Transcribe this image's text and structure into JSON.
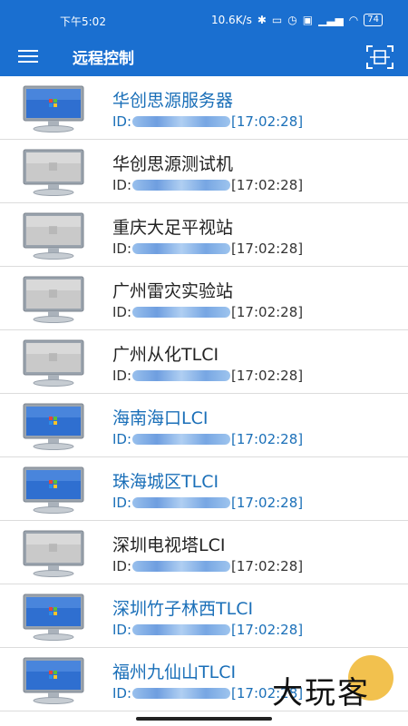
{
  "status_bar": {
    "time": "下午5:02",
    "network_speed": "10.6K/s",
    "icons": [
      "bluetooth-icon",
      "vibrate-icon",
      "alarm-icon",
      "hd-icon",
      "signal-4g-icon",
      "wifi-icon"
    ],
    "battery": "74"
  },
  "app_bar": {
    "title": "远程控制",
    "menu_icon": "hamburger-menu-icon",
    "scan_icon": "scan-code-icon"
  },
  "colors": {
    "primary": "#1a6fd0",
    "online_text": "#1a6fb8",
    "offline_text": "#222222",
    "fab": "#f2c14e"
  },
  "devices": [
    {
      "name": "华创思源服务器",
      "id_prefix": "ID:",
      "time": "[17:02:28]",
      "online": true
    },
    {
      "name": "华创思源测试机",
      "id_prefix": "ID:",
      "time": "[17:02:28]",
      "online": false
    },
    {
      "name": "重庆大足平视站",
      "id_prefix": "ID:",
      "time": "[17:02:28]",
      "online": false
    },
    {
      "name": "广州雷灾实验站",
      "id_prefix": "ID:",
      "time": "[17:02:28]",
      "online": false
    },
    {
      "name": "广州从化TLCI",
      "id_prefix": "ID:",
      "time": "[17:02:28]",
      "online": false
    },
    {
      "name": "海南海口LCI",
      "id_prefix": "ID:",
      "time": "[17:02:28]",
      "online": true
    },
    {
      "name": "珠海城区TLCI",
      "id_prefix": "ID:",
      "time": "[17:02:28]",
      "online": true
    },
    {
      "name": "深圳电视塔LCI",
      "id_prefix": "ID:",
      "time": "[17:02:28]",
      "online": false
    },
    {
      "name": "深圳竹子林西TLCI",
      "id_prefix": "ID:",
      "time": "[17:02:28]",
      "online": true
    },
    {
      "name": "福州九仙山TLCI",
      "id_prefix": "ID:",
      "time": "[17:02:28]",
      "online": true
    }
  ],
  "watermark": "大玩客"
}
